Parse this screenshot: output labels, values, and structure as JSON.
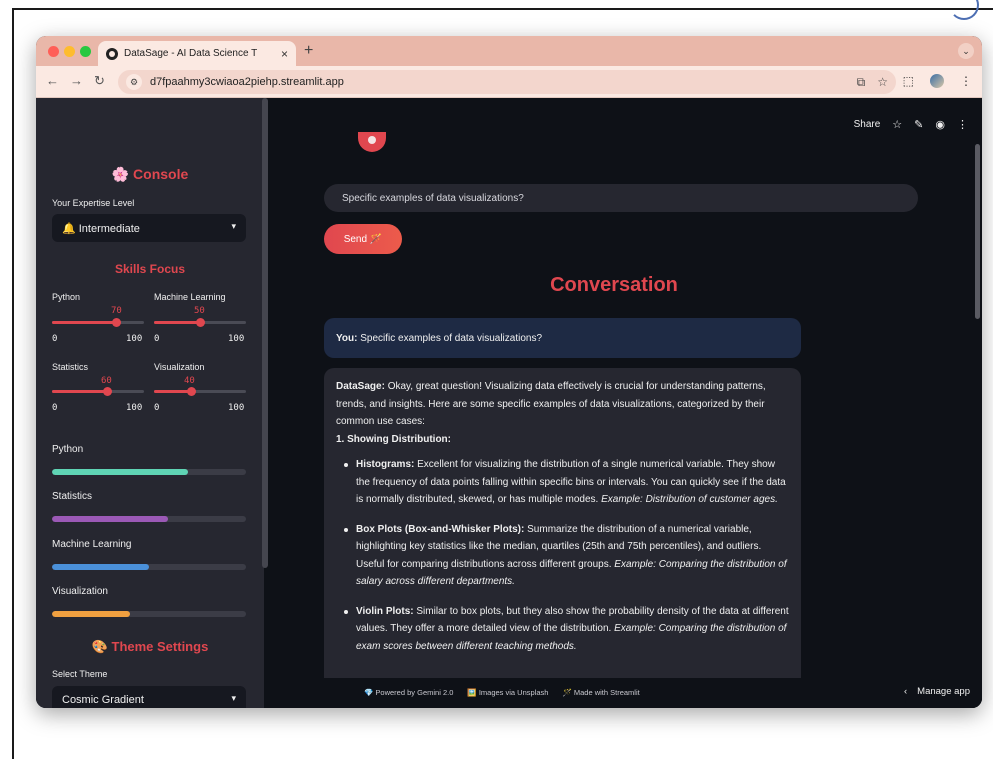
{
  "browser": {
    "tab_title": "DataSage - AI Data Science T",
    "tab_close": "×",
    "new_tab": "+",
    "url": "d7fpaahmy3cwiaoa2piehp.streamlit.app"
  },
  "sidebar": {
    "console_title": "🌸 Console",
    "expertise_label": "Your Expertise Level",
    "expertise_value": "🔔 Intermediate",
    "skills_title": "Skills Focus",
    "sliders": [
      {
        "label": "Python",
        "value": 70,
        "min": 0,
        "max": 100
      },
      {
        "label": "Machine Learning",
        "value": 50,
        "min": 0,
        "max": 100
      },
      {
        "label": "Statistics",
        "value": 60,
        "min": 0,
        "max": 100
      },
      {
        "label": "Visualization",
        "value": 40,
        "min": 0,
        "max": 100
      }
    ],
    "progress": [
      {
        "label": "Python",
        "value": 70,
        "color": "#5fd4b4"
      },
      {
        "label": "Statistics",
        "value": 60,
        "color": "#9b59b6"
      },
      {
        "label": "Machine Learning",
        "value": 50,
        "color": "#4a90d9"
      },
      {
        "label": "Visualization",
        "value": 40,
        "color": "#f0a040"
      }
    ],
    "theme_title": "🎨 Theme Settings",
    "theme_label": "Select Theme",
    "theme_value": "Cosmic Gradient"
  },
  "main": {
    "share_label": "Share",
    "input_value": "Specific examples of data visualizations?",
    "send_label": "Send 🪄",
    "conversation_title": "Conversation",
    "user_prefix": "You:",
    "user_message": "Specific examples of data visualizations?",
    "ai_prefix": "DataSage:",
    "ai_intro": "Okay, great question! Visualizing data effectively is crucial for understanding patterns, trends, and insights. Here are some specific examples of data visualizations, categorized by their common use cases:",
    "ai_section": "1. Showing Distribution:",
    "ai_items": [
      {
        "title": "Histograms:",
        "text": "Excellent for visualizing the distribution of a single numerical variable. They show the frequency of data points falling within specific bins or intervals. You can quickly see if the data is normally distributed, skewed, or has multiple modes.",
        "example": "Example: Distribution of customer ages."
      },
      {
        "title": "Box Plots (Box-and-Whisker Plots):",
        "text": "Summarize the distribution of a numerical variable, highlighting key statistics like the median, quartiles (25th and 75th percentiles), and outliers. Useful for comparing distributions across different groups.",
        "example": "Example: Comparing the distribution of salary across different departments."
      },
      {
        "title": "Violin Plots:",
        "text": "Similar to box plots, but they also show the probability density of the data at different values. They offer a more detailed view of the distribution.",
        "example": "Example: Comparing the distribution of exam scores between different teaching methods."
      }
    ]
  },
  "footer": {
    "links": [
      "💎 Powered by Gemini 2.0",
      "🖼️ Images via Unsplash",
      "🪄 Made with Streamlit"
    ],
    "manage_label": "Manage app"
  }
}
